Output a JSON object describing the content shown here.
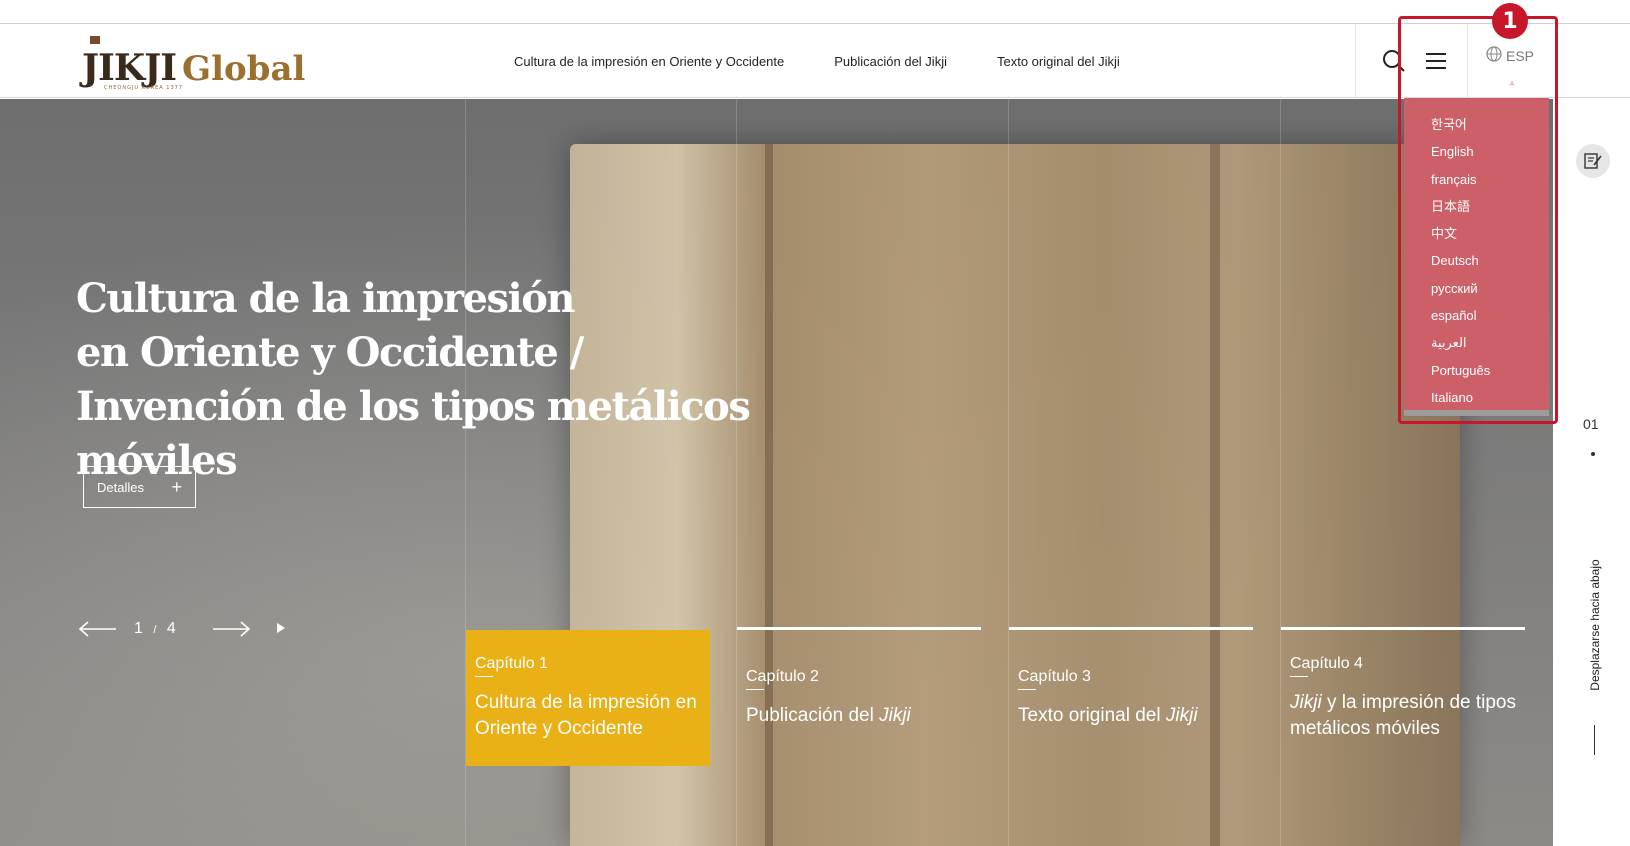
{
  "header": {
    "logo": {
      "primary": "JIKJI",
      "secondary": "Global",
      "tagline": "CHEONGJU KOREA 1377"
    },
    "nav": [
      {
        "label": "Cultura de la impresión en Oriente y Occidente"
      },
      {
        "label": "Publicación del Jikji"
      },
      {
        "label": "Texto original del Jikji"
      }
    ],
    "icons": {
      "search": "search-icon",
      "menu": "menu-icon",
      "globe": "globe-icon"
    },
    "language": {
      "current": "ESP",
      "caret": "▵"
    }
  },
  "language_menu": {
    "options": [
      "한국어",
      "English",
      "français",
      "日本語",
      "中文",
      "Deutsch",
      "русский",
      "español",
      "العربية",
      "Português",
      "Italiano"
    ]
  },
  "annotation": {
    "badge": "1",
    "color": "#c8172a"
  },
  "hero": {
    "title_lines": [
      "Cultura de la impresión",
      "en Oriente y Occidente /",
      "Invención de los tipos metálicos móviles"
    ],
    "details_button": {
      "label": "Detalles",
      "icon": "+"
    },
    "pager": {
      "current": "1",
      "separator": "/",
      "total": "4"
    },
    "chapters": [
      {
        "number": "Capítulo 1",
        "name": "Cultura de la impresión en Oriente y Occidente",
        "active": true
      },
      {
        "number": "Capítulo 2",
        "name_prefix": "Publicación del ",
        "name_em": "Jikji",
        "active": false
      },
      {
        "number": "Capítulo 3",
        "name_prefix": "Texto original del ",
        "name_em": "Jikji",
        "active": false
      },
      {
        "number": "Capítulo 4",
        "name_em": "Jikji",
        "name_suffix": " y la impresión de tipos metálicos móviles",
        "active": false
      }
    ],
    "accent_color": "#e9b115"
  },
  "rail": {
    "slide_number": "01",
    "scroll_label": "Desplazarse hacia abajo",
    "icon": "edit-note-icon"
  },
  "colors": {
    "dropdown_bg": "#cd5f68",
    "logo_brown": "#9b6f2e"
  }
}
